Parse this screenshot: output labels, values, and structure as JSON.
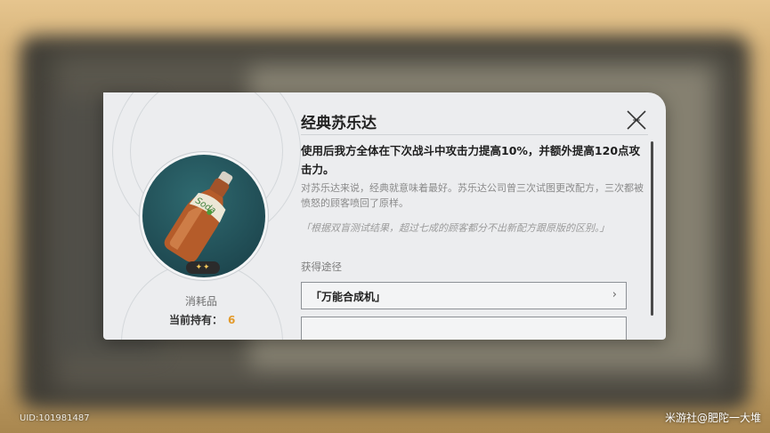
{
  "dialog": {
    "title": "经典苏乐达",
    "description": "使用后我方全体在下次战斗中攻击力提高10%，并额外提高120点攻击力。",
    "lore": "对苏乐达来说，经典就意味着最好。苏乐达公司曾三次试图更改配方，三次都被愤怒的顾客喷回了原样。",
    "quote": "「根据双盲测试结果，超过七成的顾客都分不出新配方跟原版的区别。」",
    "sources_label": "获得途径",
    "sources": [
      {
        "label": "「万能合成机」",
        "chevron": "›"
      }
    ],
    "close_icon": "close-x-icon"
  },
  "item": {
    "rarity_stars": "✦✦",
    "category": "消耗品",
    "holding_label": "当前持有：",
    "holding_count": "6",
    "icon": "soda-bottle-icon"
  },
  "footer": {
    "uid": "UID:101981487",
    "watermark": "米游社@肥陀一大堆"
  },
  "colors": {
    "accent_count": "#e39a2b",
    "dialog_bg": "#ecedef",
    "item_circle": "#1f4a52"
  }
}
